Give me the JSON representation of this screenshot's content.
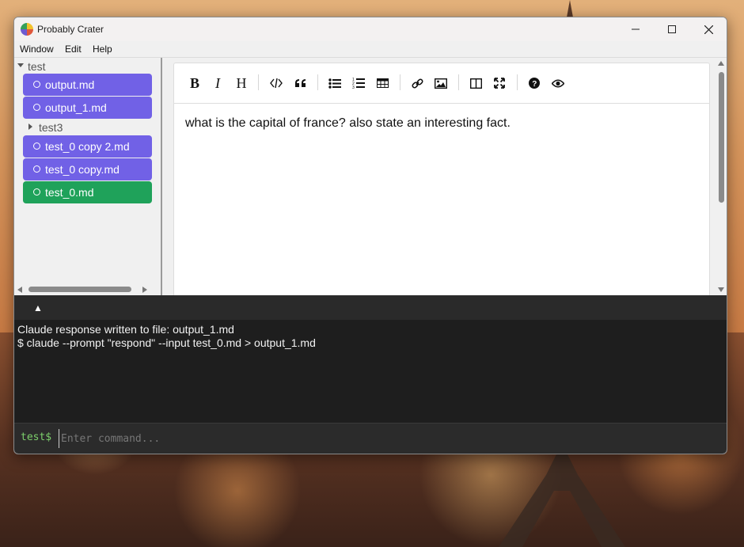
{
  "window": {
    "title": "Probably Crater"
  },
  "menu": [
    "Window",
    "Edit",
    "Help"
  ],
  "sidebar": {
    "folders": [
      "test",
      "test3"
    ],
    "items": [
      {
        "label": "output.md",
        "color": "#7161e6"
      },
      {
        "label": "output_1.md",
        "color": "#7161e6"
      },
      {
        "label": "test_0 copy 2.md",
        "color": "#7161e6"
      },
      {
        "label": "test_0 copy.md",
        "color": "#7161e6"
      },
      {
        "label": "test_0.md",
        "color": "#1fa25a"
      }
    ]
  },
  "toolbar": {
    "bold": "B",
    "italic": "I",
    "heading": "H",
    "icons": [
      "bold-icon",
      "italic-icon",
      "heading-icon",
      "code-icon",
      "quote-icon",
      "bullet-list-icon",
      "numbered-list-icon",
      "table-icon",
      "link-icon",
      "image-icon",
      "side-by-side-icon",
      "fullscreen-icon",
      "help-icon",
      "preview-icon"
    ]
  },
  "editor": {
    "content": "what is the capital of france? also state an interesting fact."
  },
  "terminal": {
    "toggle": "▲",
    "lines": [
      "Claude response written to file: output_1.md",
      "$ claude --prompt \"respond\" --input test_0.md > output_1.md"
    ],
    "prompt": "test$",
    "placeholder": "Enter command..."
  }
}
